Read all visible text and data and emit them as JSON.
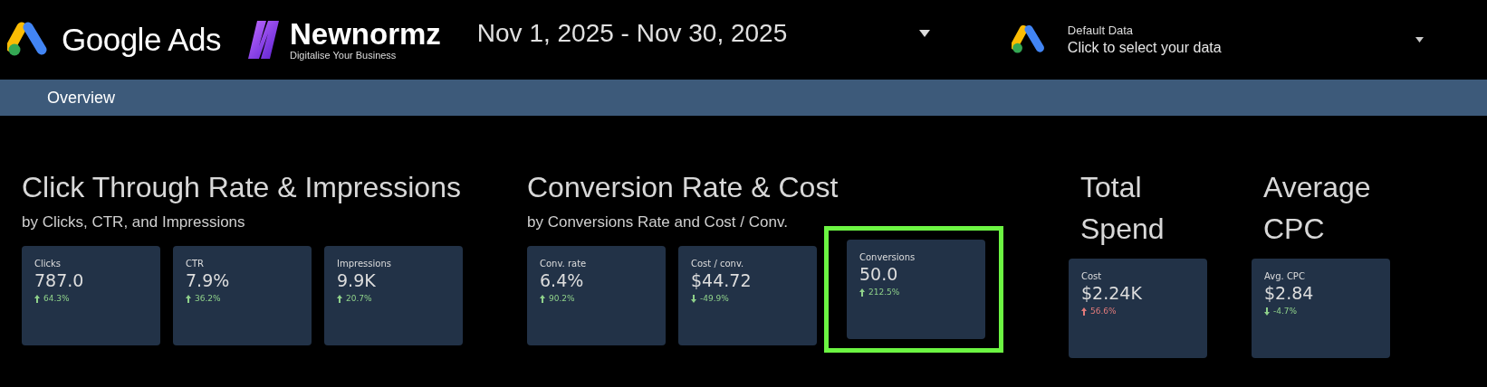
{
  "header": {
    "brand": "Google Ads",
    "partner": {
      "name": "Newnormz",
      "tagline": "Digitalise Your Business"
    },
    "date_range": "Nov 1, 2025 - Nov 30, 2025",
    "data_source": {
      "label": "Default Data",
      "value": "Click to select your data"
    }
  },
  "tabs": [
    {
      "label": "Overview",
      "selected": true
    }
  ],
  "sections": [
    {
      "title": "Click Through Rate & Impressions",
      "subtitle": "by Clicks, CTR, and Impressions",
      "cards": [
        {
          "label": "Clicks",
          "value": "787.0",
          "change": "64.3%",
          "rising": true,
          "favorable": true,
          "highlighted": false
        },
        {
          "label": "CTR",
          "value": "7.9%",
          "change": "36.2%",
          "rising": true,
          "favorable": true,
          "highlighted": false
        },
        {
          "label": "Impressions",
          "value": "9.9K",
          "change": "20.7%",
          "rising": true,
          "favorable": true,
          "highlighted": false
        }
      ]
    },
    {
      "title": "Conversion Rate & Cost",
      "subtitle": "by Conversions Rate and Cost / Conv.",
      "cards": [
        {
          "label": "Conv. rate",
          "value": "6.4%",
          "change": "90.2%",
          "rising": true,
          "favorable": true,
          "highlighted": false
        },
        {
          "label": "Cost / conv.",
          "value": "$44.72",
          "change": "-49.9%",
          "rising": false,
          "favorable": true,
          "highlighted": false
        },
        {
          "label": "Conversions",
          "value": "50.0",
          "change": "212.5%",
          "rising": true,
          "favorable": true,
          "highlighted": true
        }
      ]
    },
    {
      "title": "Total Spend",
      "cards": [
        {
          "label": "Cost",
          "value": "$2.24K",
          "change": "56.6%",
          "rising": true,
          "favorable": false,
          "highlighted": false
        }
      ]
    },
    {
      "title": "Average CPC",
      "cards": [
        {
          "label": "Avg. CPC",
          "value": "$2.84",
          "change": "-4.7%",
          "rising": false,
          "favorable": true,
          "highlighted": false
        }
      ]
    }
  ]
}
